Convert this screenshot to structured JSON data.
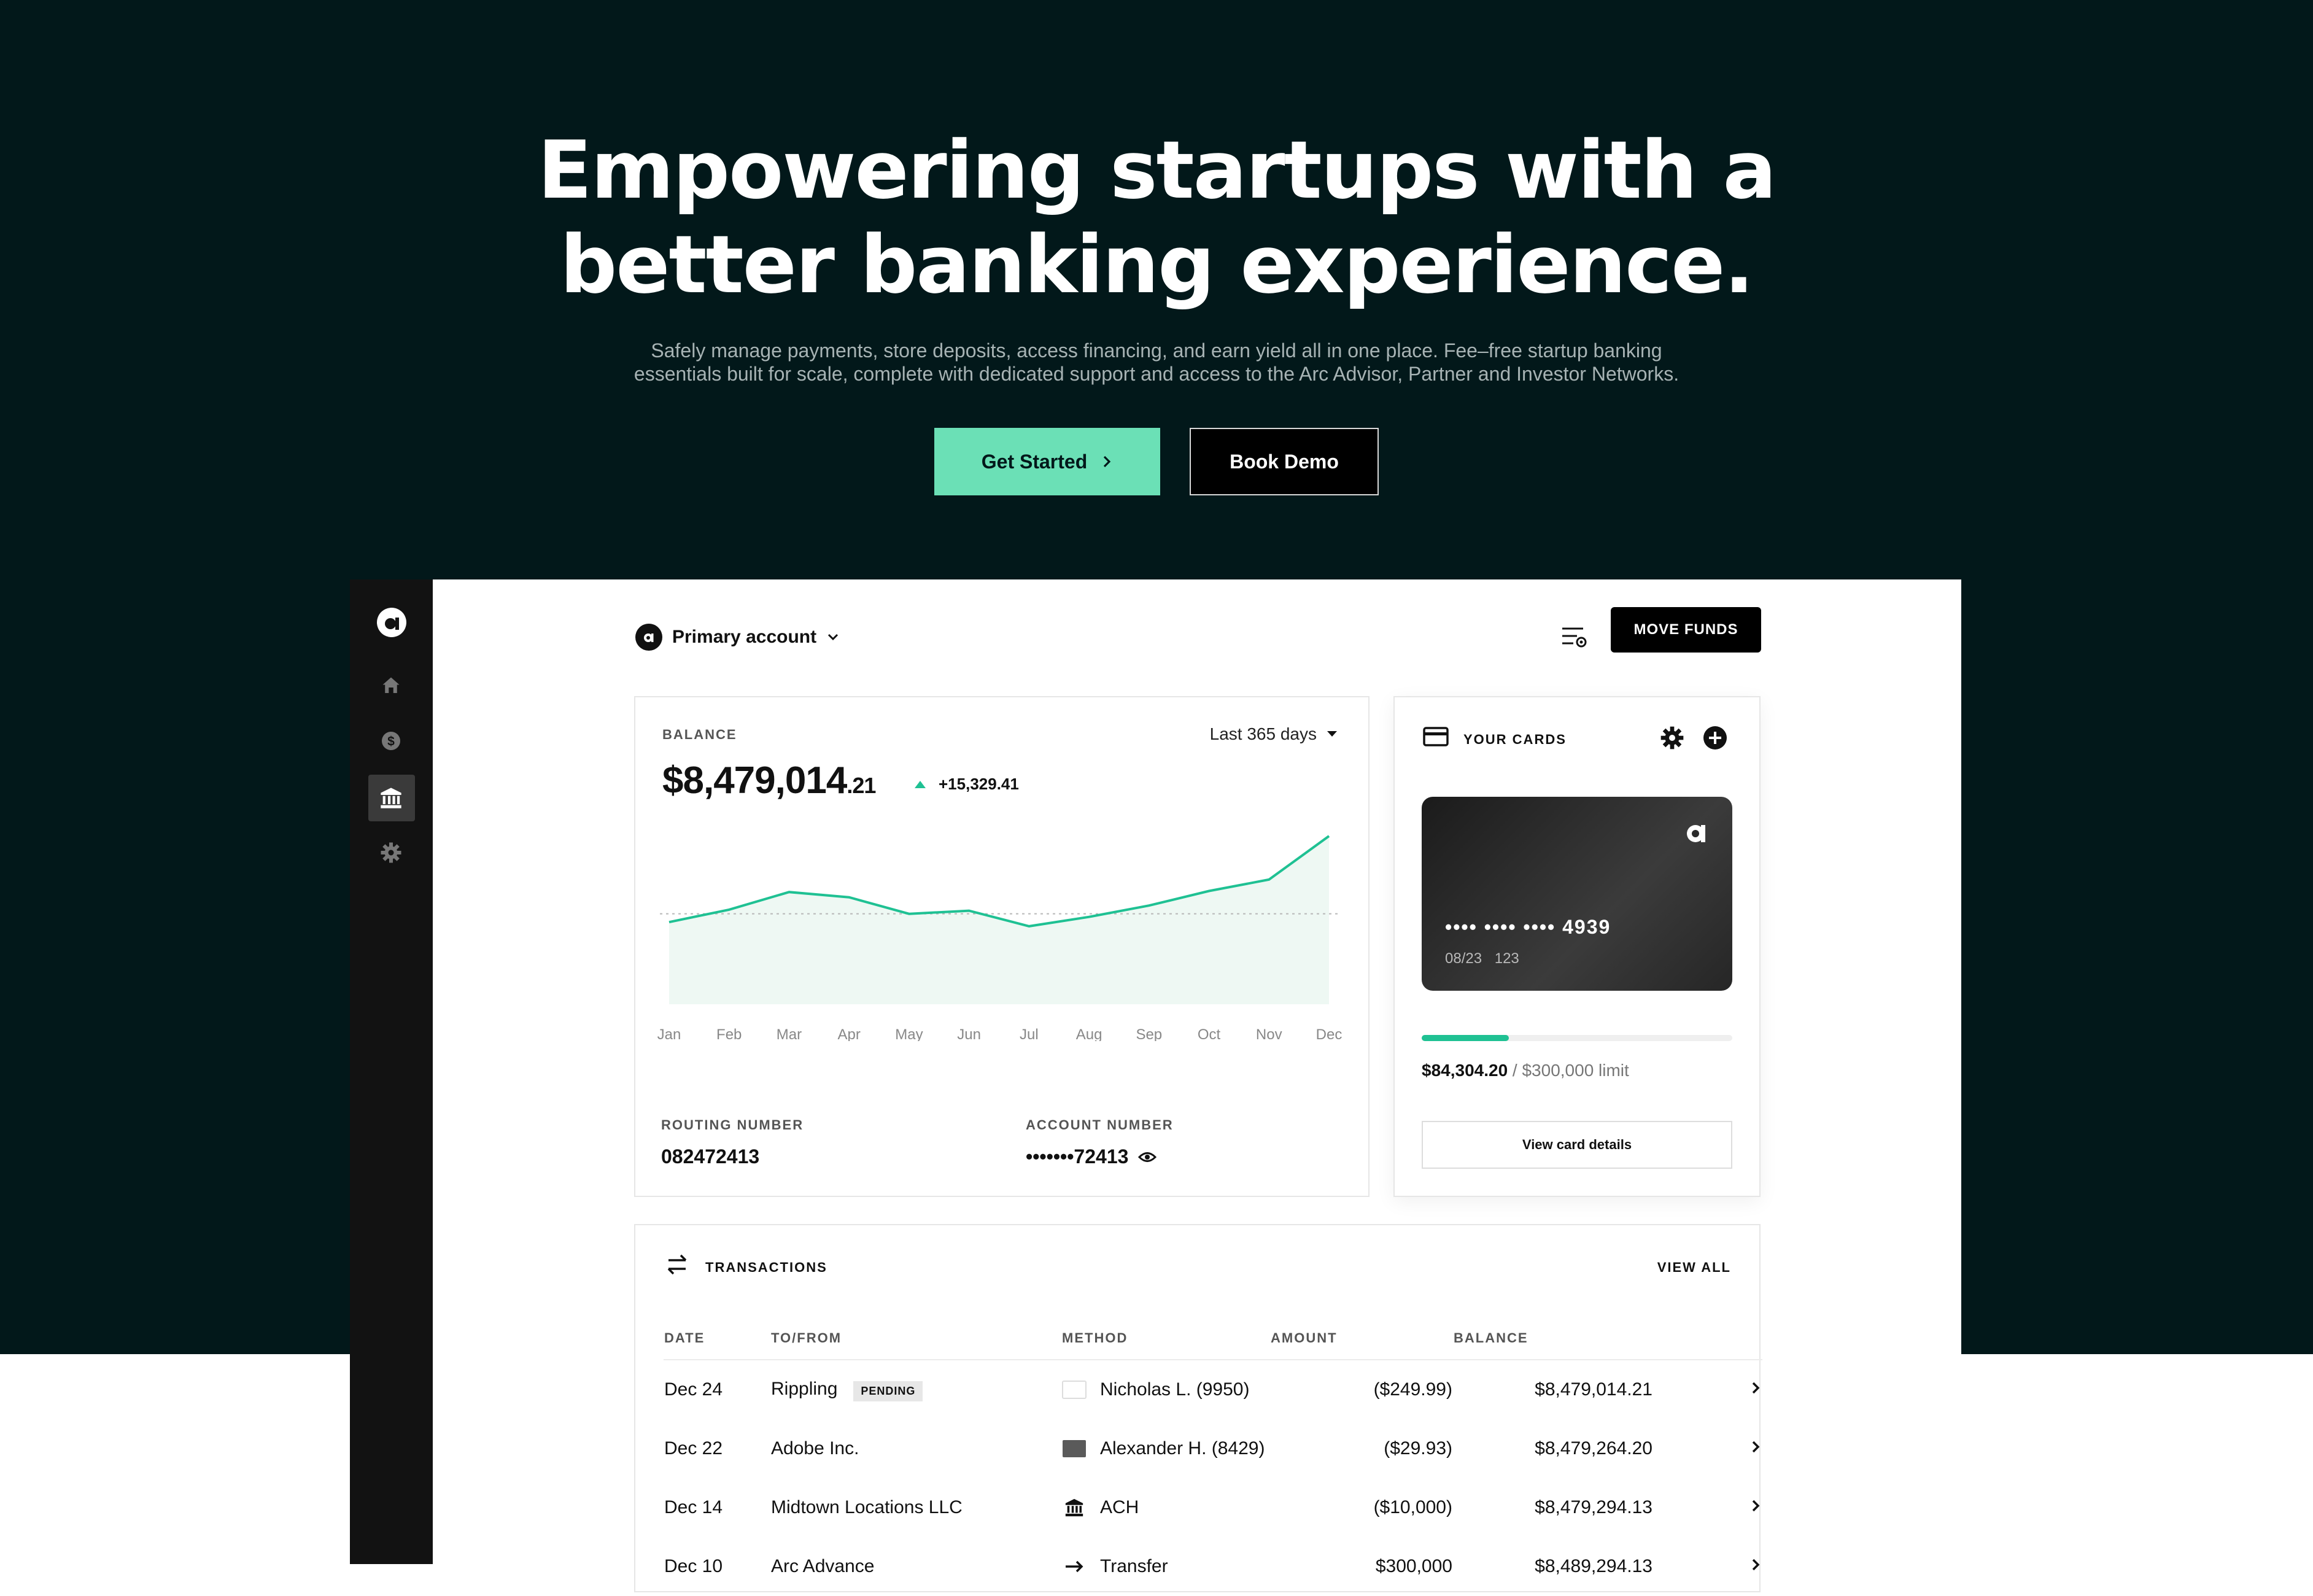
{
  "hero": {
    "title_line1": "Empowering startups with a",
    "title_line2": "better banking experience.",
    "sub_line1": "Safely manage payments, store deposits, access financing, and earn yield all in one place. Fee–free startup banking",
    "sub_line2": "essentials built for scale, complete with dedicated support and access to the Arc Advisor, Partner and Investor Networks.",
    "cta_primary": "Get Started",
    "cta_secondary": "Book Demo"
  },
  "sidebar": {
    "items": [
      {
        "icon": "home-icon",
        "active": false
      },
      {
        "icon": "dollar-icon",
        "active": false
      },
      {
        "icon": "bank-icon",
        "active": true
      },
      {
        "icon": "gear-icon",
        "active": false
      }
    ]
  },
  "header": {
    "account_label": "Primary account",
    "move_funds_label": "MOVE FUNDS"
  },
  "balance": {
    "label": "BALANCE",
    "amount_main": "$8,479,014",
    "amount_cents": ".21",
    "delta": "+15,329.41",
    "range": "Last 365 days",
    "routing_label": "ROUTING NUMBER",
    "routing_value": "082472413",
    "account_label": "ACCOUNT NUMBER",
    "account_value": "•••••••72413"
  },
  "chart_data": {
    "type": "area",
    "categories": [
      "Jan",
      "Feb",
      "Mar",
      "Apr",
      "May",
      "Jun",
      "Jul",
      "Aug",
      "Sep",
      "Oct",
      "Nov",
      "Dec"
    ],
    "values": [
      42,
      54,
      71,
      66,
      50,
      53,
      38,
      47,
      58,
      72,
      83,
      125
    ],
    "baseline": 50,
    "ylim": [
      -30,
      125
    ],
    "grid": false,
    "color": "#1fc193"
  },
  "cards": {
    "title": "YOUR CARDS",
    "number": "•••• •••• •••• 4939",
    "expiry": "08/23",
    "cvv": "123",
    "spent": "$84,304.20",
    "limit": " / $300,000 limit",
    "spent_fraction": 0.281,
    "details_label": "View card details"
  },
  "transactions": {
    "title": "TRANSACTIONS",
    "view_all": "VIEW ALL",
    "columns": [
      "DATE",
      "TO/FROM",
      "METHOD",
      "AMOUNT",
      "BALANCE"
    ],
    "rows": [
      {
        "date": "Dec 24",
        "party": "Rippling",
        "badge": "PENDING",
        "method": "Nicholas L. (9950)",
        "method_icon": "card-light-icon",
        "amount": "($249.99)",
        "balance": "$8,479,014.21"
      },
      {
        "date": "Dec 22",
        "party": "Adobe Inc.",
        "badge": "",
        "method": "Alexander H. (8429)",
        "method_icon": "card-dark-icon",
        "amount": "($29.93)",
        "balance": "$8,479,264.20"
      },
      {
        "date": "Dec 14",
        "party": "Midtown Locations LLC",
        "badge": "",
        "method": "ACH",
        "method_icon": "bank-icon",
        "amount": "($10,000)",
        "balance": "$8,479,294.13"
      },
      {
        "date": "Dec 10",
        "party": "Arc Advance",
        "badge": "",
        "method": "Transfer",
        "method_icon": "transfer-icon",
        "amount": "$300,000",
        "balance": "$8,489,294.13"
      }
    ]
  }
}
